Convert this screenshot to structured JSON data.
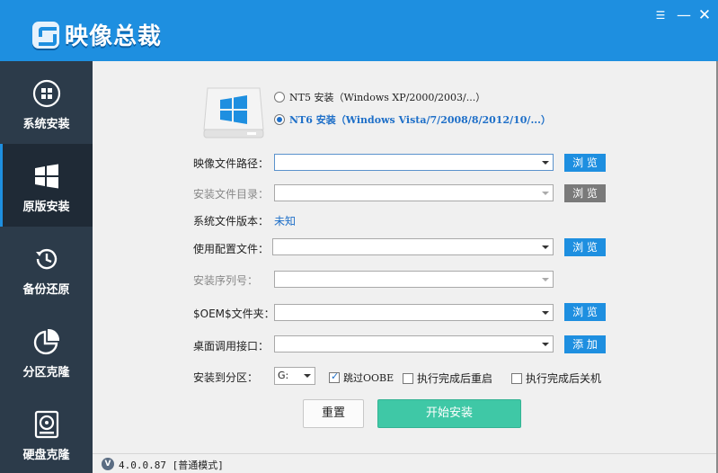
{
  "window": {
    "title": "映像总裁",
    "menu_icon": "hamburger-icon",
    "min_icon": "minimize-icon",
    "close_icon": "close-icon",
    "accent": "#1e8fe0"
  },
  "sidebar": {
    "items": [
      {
        "label": "系统安装",
        "icon": "windows-disc-icon"
      },
      {
        "label": "原版安装",
        "icon": "windows-logo-icon"
      },
      {
        "label": "备份还原",
        "icon": "clock-restore-icon"
      },
      {
        "label": "分区克隆",
        "icon": "pie-partition-icon"
      },
      {
        "label": "硬盘克隆",
        "icon": "harddisk-icon"
      }
    ],
    "active": "原版安装"
  },
  "install_mode": {
    "nt5_label": "NT5 安装（Windows XP/2000/2003/...）",
    "nt6_label": "NT6 安装（Windows Vista/7/2008/8/2012/10/...）",
    "selected": "NT6"
  },
  "form": {
    "image_path": {
      "label": "映像文件路径：",
      "value": "",
      "button": "浏 览"
    },
    "install_dir": {
      "label": "安装文件目录：",
      "value": "",
      "button": "浏 览"
    },
    "sys_version": {
      "label": "系统文件版本：",
      "value": "未知"
    },
    "config_file": {
      "label": "使用配置文件：",
      "value": "",
      "button": "浏 览"
    },
    "serial": {
      "label": "安装序列号：",
      "value": ""
    },
    "oem_folder": {
      "label": "$OEM$文件夹：",
      "value": "",
      "button": "浏 览"
    },
    "desktop_api": {
      "label": "桌面调用接口：",
      "value": "",
      "button": "添 加"
    },
    "partition": {
      "label": "安装到分区：",
      "value": "G:"
    },
    "options": [
      {
        "label": "跳过OOBE",
        "checked": true
      },
      {
        "label": "执行完成后重启",
        "checked": false
      },
      {
        "label": "执行完成后关机",
        "checked": false
      }
    ]
  },
  "actions": {
    "reset": "重置",
    "start": "开始安装"
  },
  "status": {
    "badge": "V",
    "text": "4.0.0.87 [普通模式]"
  }
}
